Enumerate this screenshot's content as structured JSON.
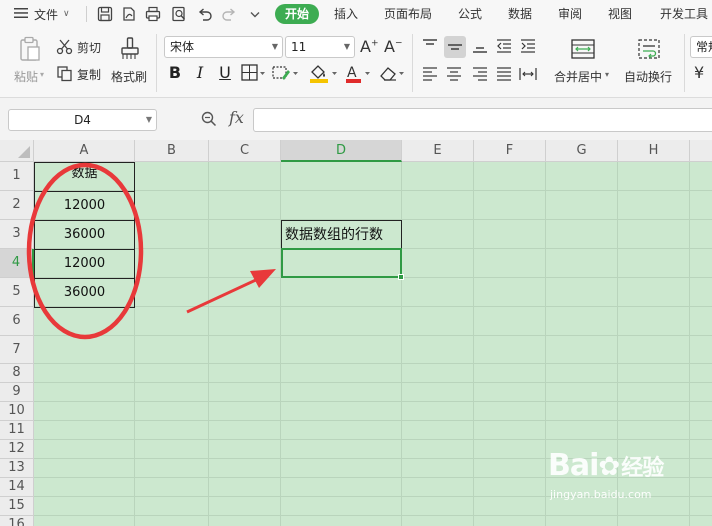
{
  "menubar": {
    "menu_label": "文件",
    "tabs": [
      "开始",
      "插入",
      "页面布局",
      "公式",
      "数据",
      "审阅",
      "视图",
      "开发工具"
    ]
  },
  "ribbon": {
    "paste": "粘贴",
    "cut": "剪切",
    "copy": "复制",
    "format_painter": "格式刷",
    "font_name": "宋体",
    "font_size": "11",
    "merge_center": "合并居中",
    "wrap_text": "自动换行",
    "number_format": "常规"
  },
  "formula_bar": {
    "name_box": "D4",
    "fx_label": "fx",
    "formula": ""
  },
  "sheet": {
    "columns": [
      "A",
      "B",
      "C",
      "D",
      "E",
      "F",
      "G",
      "H"
    ],
    "rows": [
      "1",
      "2",
      "3",
      "4",
      "5",
      "6",
      "7",
      "8",
      "9",
      "10",
      "11",
      "12",
      "13",
      "14",
      "15",
      "16"
    ],
    "selected_cell": "D4",
    "cells": {
      "A1": "数据",
      "A2": "12000",
      "A3": "36000",
      "A4": "12000",
      "A5": "36000",
      "D3": "数据数组的行数"
    }
  },
  "watermark": {
    "brand": "Bai",
    "brand_cn": "经验",
    "url": "jingyan.baidu.com"
  },
  "colors": {
    "accent": "#3dac52",
    "sheet_bg": "#cce8cf",
    "annotation": "#e8393a"
  }
}
